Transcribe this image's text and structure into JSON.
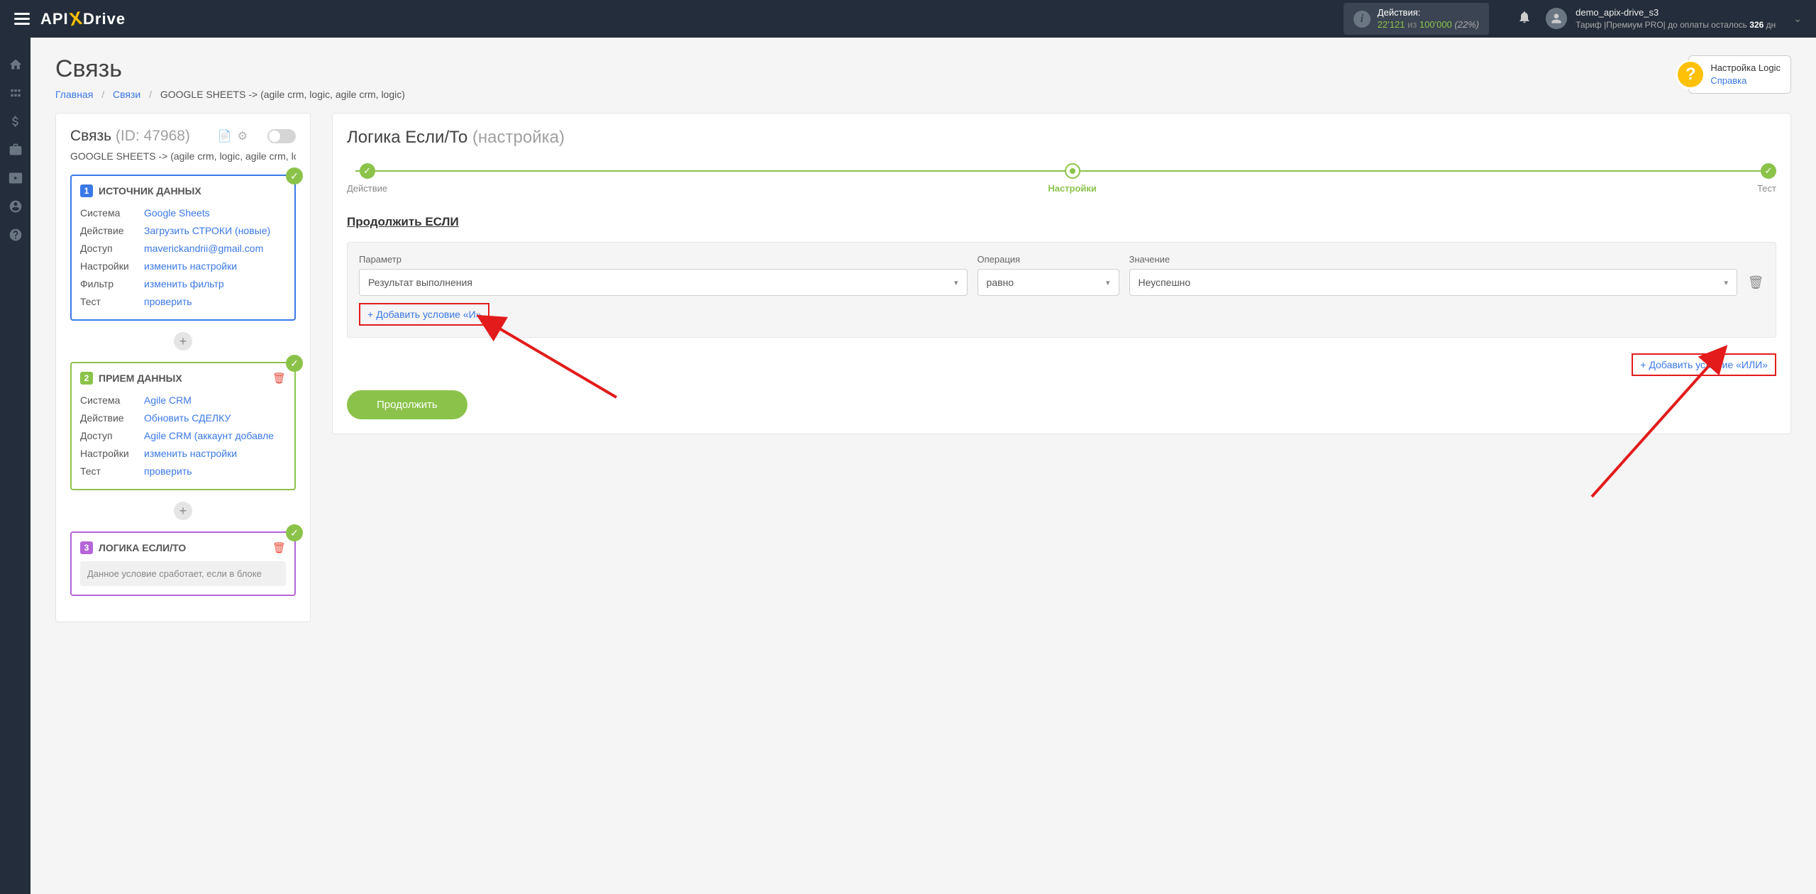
{
  "topbar": {
    "logo_part1": "API",
    "logo_part2": "Drive",
    "actions_label": "Действия:",
    "actions_count": "22'121",
    "actions_of": "из",
    "actions_total": "100'000",
    "actions_pct": "(22%)",
    "user_name": "demo_apix-drive_s3",
    "tariff_prefix": "Тариф |Премиум PRO| до оплаты осталось ",
    "tariff_days": "326",
    "tariff_suffix": " дн"
  },
  "page": {
    "title": "Связь",
    "breadcrumb": {
      "home": "Главная",
      "links": "Связи",
      "current": "GOOGLE SHEETS -> (agile crm, logic, agile crm, logic)"
    },
    "help": {
      "title": "Настройка Logic",
      "link": "Справка"
    }
  },
  "left": {
    "conn_label": "Связь",
    "conn_id": "(ID: 47968)",
    "conn_sub": "GOOGLE SHEETS -> (agile crm, logic, agile crm, lo",
    "labels": {
      "system": "Система",
      "action": "Действие",
      "access": "Доступ",
      "settings": "Настройки",
      "filter": "Фильтр",
      "test": "Тест"
    },
    "block1": {
      "title": "ИСТОЧНИК ДАННЫХ",
      "system": "Google Sheets",
      "action": "Загрузить СТРОКИ (новые)",
      "access": "maverickandrii@gmail.com",
      "settings": "изменить настройки",
      "filter": "изменить фильтр",
      "test": "проверить"
    },
    "block2": {
      "title": "ПРИЕМ ДАННЫХ",
      "system": "Agile CRM",
      "action": "Обновить СДЕЛКУ",
      "access": "Agile CRM (аккаунт добавле",
      "settings": "изменить настройки",
      "test": "проверить"
    },
    "block3": {
      "title": "ЛОГИКА ЕСЛИ/ТО",
      "note": "Данное условие сработает, если в блоке"
    }
  },
  "right": {
    "title": "Логика Если/То",
    "title_sub": "(настройка)",
    "steps": {
      "s1": "Действие",
      "s2": "Настройки",
      "s3": "Тест"
    },
    "section": "Продолжить ЕСЛИ",
    "cond": {
      "param_label": "Параметр",
      "op_label": "Операция",
      "val_label": "Значение",
      "param": "Результат выполнения",
      "op": "равно",
      "val": "Неуспешно",
      "add_and": "Добавить условие «И»",
      "add_or": "Добавить условие «ИЛИ»"
    },
    "continue": "Продолжить"
  }
}
